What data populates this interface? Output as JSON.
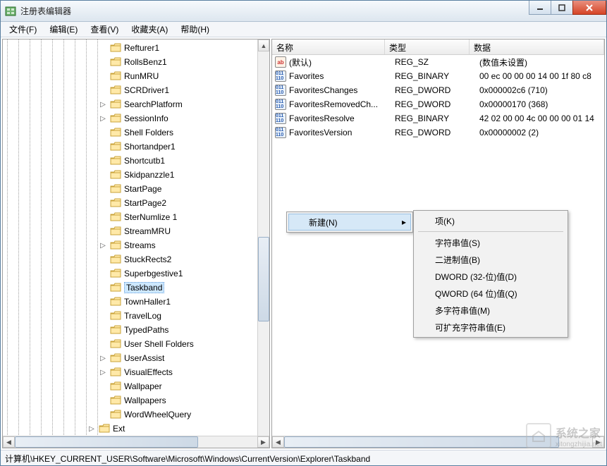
{
  "window": {
    "title": "注册表编辑器"
  },
  "menu": {
    "file": "文件(F)",
    "edit": "编辑(E)",
    "view": "查看(V)",
    "favorites": "收藏夹(A)",
    "help": "帮助(H)"
  },
  "tree": {
    "items": [
      {
        "label": "Refturer1"
      },
      {
        "label": "RollsBenz1"
      },
      {
        "label": "RunMRU"
      },
      {
        "label": "SCRDriver1"
      },
      {
        "label": "SearchPlatform",
        "expandable": true
      },
      {
        "label": "SessionInfo",
        "expandable": true
      },
      {
        "label": "Shell Folders"
      },
      {
        "label": "Shortandper1"
      },
      {
        "label": "Shortcutb1"
      },
      {
        "label": "Skidpanzzle1"
      },
      {
        "label": "StartPage"
      },
      {
        "label": "StartPage2"
      },
      {
        "label": "SterNumlize 1"
      },
      {
        "label": "StreamMRU"
      },
      {
        "label": "Streams",
        "expandable": true
      },
      {
        "label": "StuckRects2"
      },
      {
        "label": "Superbgestive1"
      },
      {
        "label": "Taskband",
        "selected": true
      },
      {
        "label": "TownHaller1"
      },
      {
        "label": "TravelLog"
      },
      {
        "label": "TypedPaths"
      },
      {
        "label": "User Shell Folders"
      },
      {
        "label": "UserAssist",
        "expandable": true
      },
      {
        "label": "VisualEffects",
        "expandable": true
      },
      {
        "label": "Wallpaper"
      },
      {
        "label": "Wallpapers"
      },
      {
        "label": "WordWheelQuery"
      }
    ],
    "extLabel": "Ext"
  },
  "list": {
    "cols": {
      "name": "名称",
      "type": "类型",
      "data": "数据"
    },
    "rows": [
      {
        "icon": "str",
        "name": "(默认)",
        "type": "REG_SZ",
        "data": "(数值未设置)"
      },
      {
        "icon": "bin",
        "name": "Favorites",
        "type": "REG_BINARY",
        "data": "00 ec 00 00 00 14 00 1f 80 c8"
      },
      {
        "icon": "bin",
        "name": "FavoritesChanges",
        "type": "REG_DWORD",
        "data": "0x000002c6 (710)"
      },
      {
        "icon": "bin",
        "name": "FavoritesRemovedCh...",
        "type": "REG_DWORD",
        "data": "0x00000170 (368)"
      },
      {
        "icon": "bin",
        "name": "FavoritesResolve",
        "type": "REG_BINARY",
        "data": "42 02 00 00 4c 00 00 00 01 14"
      },
      {
        "icon": "bin",
        "name": "FavoritesVersion",
        "type": "REG_DWORD",
        "data": "0x00000002 (2)"
      }
    ]
  },
  "context": {
    "newLabel": "新建(N)",
    "sub": {
      "key": "项(K)",
      "string": "字符串值(S)",
      "binary": "二进制值(B)",
      "dword": "DWORD (32-位)值(D)",
      "qword": "QWORD (64 位)值(Q)",
      "multi": "多字符串值(M)",
      "expand": "可扩充字符串值(E)"
    }
  },
  "statusbar": "计算机\\HKEY_CURRENT_USER\\Software\\Microsoft\\Windows\\CurrentVersion\\Explorer\\Taskband",
  "watermark": {
    "text": "系统之家",
    "sub": "xitongzhijia.net"
  }
}
